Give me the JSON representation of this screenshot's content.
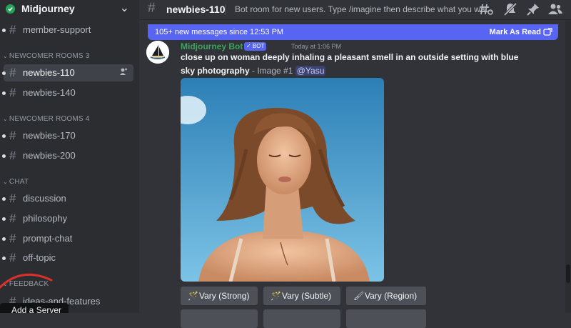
{
  "server": {
    "name": "Midjourney"
  },
  "sidebar": {
    "channels": [
      {
        "label": "member-support"
      },
      {
        "label": "newbies-110"
      },
      {
        "label": "newbies-140"
      },
      {
        "label": "newbies-170"
      },
      {
        "label": "newbies-200"
      },
      {
        "label": "discussion"
      },
      {
        "label": "philosophy"
      },
      {
        "label": "prompt-chat"
      },
      {
        "label": "off-topic"
      },
      {
        "label": "ideas-and-features"
      }
    ],
    "categories": [
      {
        "label": "NEWCOMER ROOMS 3"
      },
      {
        "label": "NEWCOMER ROOMS 4"
      },
      {
        "label": "CHAT"
      },
      {
        "label": "FEEDBACK"
      }
    ],
    "tooltip": "Add a Server"
  },
  "topbar": {
    "channel_name": "newbies-110",
    "topic": "Bot room for new users. Type /imagine then describe what you wa..."
  },
  "new_messages": {
    "text": "105+ new messages since 12:53 PM",
    "mark_label": "Mark As Read"
  },
  "message": {
    "author": "Midjourney Bot",
    "badge": "✓ BOT",
    "timestamp": "Today at 1:06 PM",
    "line1": "close up on woman deeply inhaling a pleasant smell in an outside setting with blue",
    "line2_bold": "sky photography",
    "line2_sub": " - Image #1 ",
    "mention": "@Yasu"
  },
  "buttons": [
    {
      "label": "Vary (Strong)",
      "icon": "magic-wand-icon"
    },
    {
      "label": "Vary (Subtle)",
      "icon": "magic-wand-icon"
    },
    {
      "label": "Vary (Region)",
      "icon": "paintbrush-icon"
    }
  ],
  "colors": {
    "accent": "#5865f2",
    "bot_name": "#3ba55c",
    "background": "#313338",
    "sidebar": "#2b2d31",
    "online": "#23a55a"
  }
}
